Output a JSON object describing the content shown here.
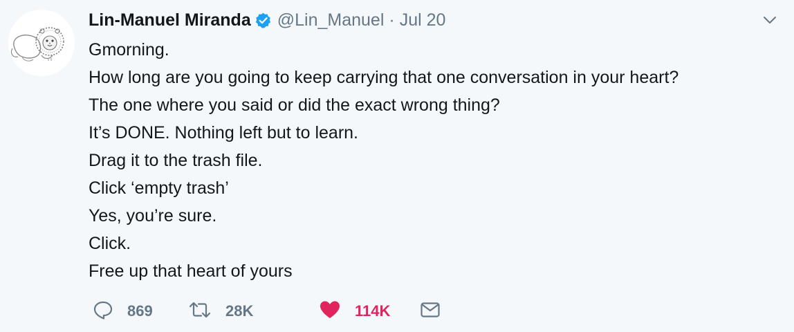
{
  "tweet": {
    "author_name": "Lin-Manuel Miranda",
    "handle": "@Lin_Manuel",
    "separator": "·",
    "date": "Jul 20",
    "verified": true,
    "avatar_icon": "lion-sketch-avatar",
    "lines": [
      "Gmorning.",
      "How long are you going to keep carrying that one conversation in your heart?",
      "The one where you said or did the exact wrong thing?",
      "It’s DONE. Nothing left but to learn.",
      "Drag it to the trash file.",
      "Click ‘empty trash’",
      "Yes, you’re sure.",
      "Click.",
      "Free up that heart of yours"
    ],
    "actions": {
      "reply_count": "869",
      "retweet_count": "28K",
      "like_count": "114K"
    }
  },
  "colors": {
    "background": "#f5f8fa",
    "text": "#14171a",
    "muted": "#657786",
    "verified_blue": "#1da1f2",
    "like_red": "#e0245e"
  }
}
